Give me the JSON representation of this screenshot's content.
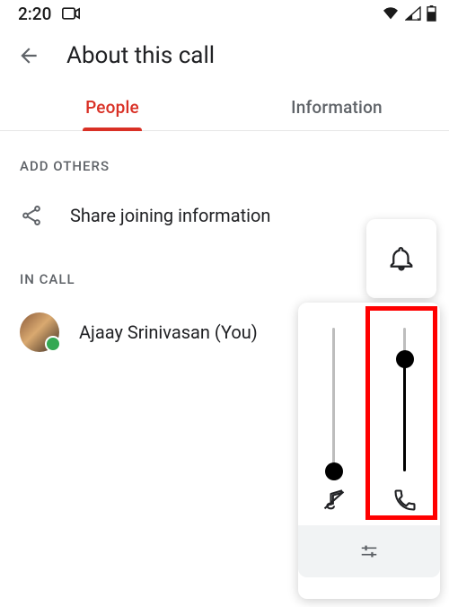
{
  "status": {
    "time": "2:20"
  },
  "header": {
    "title": "About this call"
  },
  "tabs": {
    "people": "People",
    "information": "Information"
  },
  "sections": {
    "add_others": "ADD OTHERS",
    "in_call": "IN CALL"
  },
  "share": {
    "label": "Share joining information"
  },
  "participant": {
    "name": "Ajaay Srinivasan (You)"
  },
  "volume": {
    "media": {
      "level_pct": 0
    },
    "call": {
      "level_pct": 78
    }
  }
}
